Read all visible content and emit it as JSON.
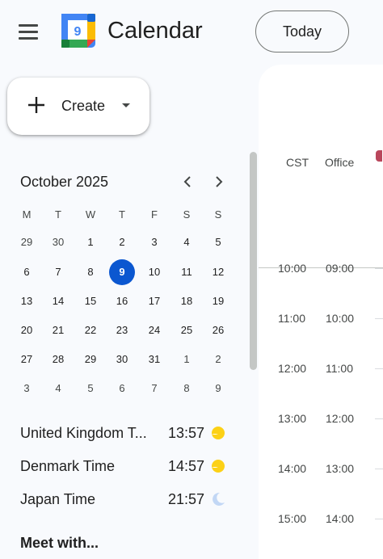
{
  "header": {
    "menu_icon": "hamburger-menu-icon",
    "logo_day": "9",
    "app_title": "Calendar",
    "today_label": "Today"
  },
  "create": {
    "label": "Create",
    "icon": "plus-icon",
    "caret_icon": "caret-down-icon"
  },
  "mini_calendar": {
    "month_title": "October 2025",
    "prev_icon": "chevron-left-icon",
    "next_icon": "chevron-right-icon",
    "weekdays": [
      "M",
      "T",
      "W",
      "T",
      "F",
      "S",
      "S"
    ],
    "weeks": [
      [
        "29",
        "30",
        "1",
        "2",
        "3",
        "4",
        "5"
      ],
      [
        "6",
        "7",
        "8",
        "9",
        "10",
        "11",
        "12"
      ],
      [
        "13",
        "14",
        "15",
        "16",
        "17",
        "18",
        "19"
      ],
      [
        "20",
        "21",
        "22",
        "23",
        "24",
        "25",
        "26"
      ],
      [
        "27",
        "28",
        "29",
        "30",
        "31",
        "1",
        "2"
      ],
      [
        "3",
        "4",
        "5",
        "6",
        "7",
        "8",
        "9"
      ]
    ],
    "selected_day": "9"
  },
  "world_clocks": [
    {
      "name": "United Kingdom T...",
      "time": "13:57",
      "icon": "sun-icon"
    },
    {
      "name": "Denmark Time",
      "time": "14:57",
      "icon": "sun-icon"
    },
    {
      "name": "Japan Time",
      "time": "21:57",
      "icon": "moon-icon"
    }
  ],
  "meet_with": "Meet with...",
  "timezones": {
    "primary_label": "CST",
    "secondary_label": "Office"
  },
  "time_rows": [
    {
      "cst": "10:00",
      "office": "09:00"
    },
    {
      "cst": "11:00",
      "office": "10:00"
    },
    {
      "cst": "12:00",
      "office": "11:00"
    },
    {
      "cst": "13:00",
      "office": "12:00"
    },
    {
      "cst": "14:00",
      "office": "13:00"
    },
    {
      "cst": "15:00",
      "office": "14:00"
    }
  ],
  "colors": {
    "accent": "#0b57d0",
    "event_pink": "#f4c2d7",
    "event_yellow": "#fcefc4",
    "sun": "#fcd116",
    "moon": "#c2d7f5"
  }
}
